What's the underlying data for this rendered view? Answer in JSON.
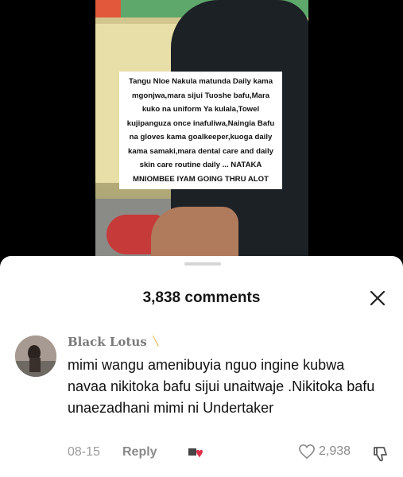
{
  "video": {
    "caption": "Tangu Nloe Nakula matunda Daily kama mgonjwa,mara sijui Tuoshe bafu,Mara kuko na uniform Ya kulala,Towel kujipanguza once inafuliwa,Naingia Bafu na gloves kama goalkeeper,kuoga daily kama samaki,mara dental care and daily skin care routine daily ... NATAKA MNIOMBEE IYAM GOING THRU ALOT"
  },
  "comments_sheet": {
    "title": "3,838 comments",
    "close_icon": "close-icon"
  },
  "comment": {
    "username": "Black Lotus",
    "username_badge": "〵",
    "text": "mimi wangu amenibuyia nguo ingine kubwa navaa nikitoka bafu sijui unaitwaje .Nikitoka bafu unaezadhani mimi ni Undertaker",
    "date": "08-15",
    "reply_label": "Reply",
    "like_count": "2,938",
    "colors": {
      "text": "#111111",
      "meta": "#9a9a9a"
    }
  }
}
